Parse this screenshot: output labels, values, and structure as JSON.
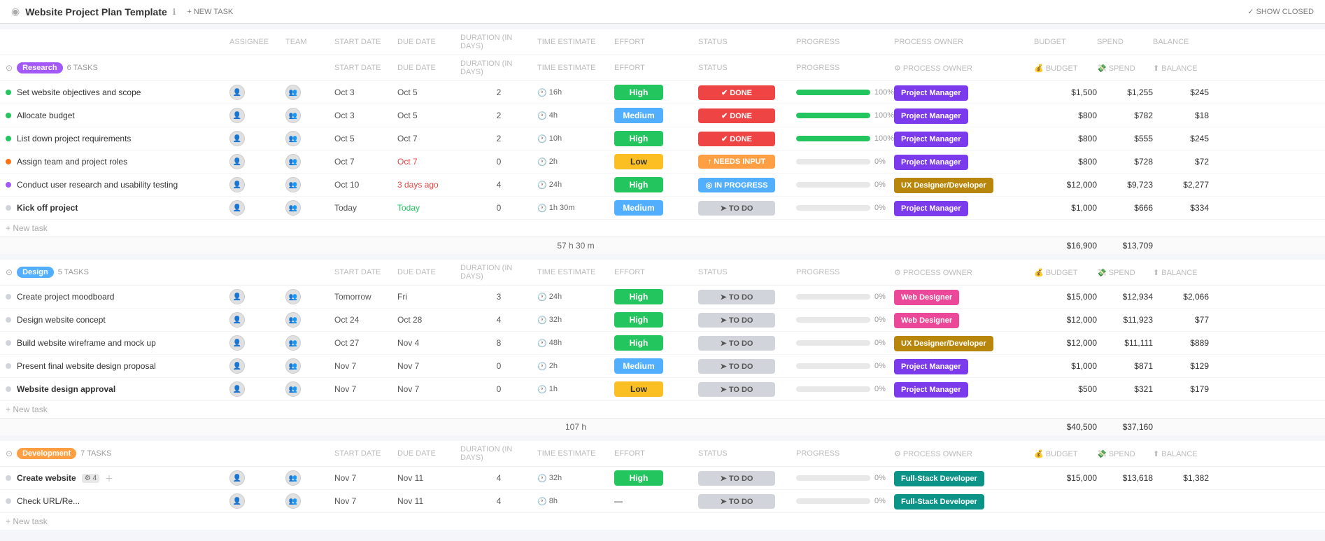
{
  "header": {
    "title": "Website Project Plan Template",
    "info_icon": "ℹ",
    "new_task_label": "+ NEW TASK",
    "show_closed_label": "✓ SHOW CLOSED"
  },
  "columns": [
    "ASSIGNEE",
    "TEAM",
    "START DATE",
    "DUE DATE",
    "DURATION (IN DAYS)",
    "TIME ESTIMATE",
    "EFFORT",
    "STATUS",
    "PROGRESS",
    "PROCESS OWNER",
    "BUDGET",
    "SPEND",
    "BALANCE"
  ],
  "sections": [
    {
      "id": "research",
      "name": "Research",
      "badge_class": "research",
      "task_count": "6 TASKS",
      "tasks": [
        {
          "name": "Set website objectives and scope",
          "dot": "green",
          "bold": false,
          "start": "Oct 3",
          "due": "Oct 5",
          "due_color": "normal",
          "duration": "2",
          "time_est": "16h",
          "effort": "High",
          "effort_class": "high",
          "status": "✔ DONE",
          "status_class": "done",
          "progress": 100,
          "owner": "Project Manager",
          "owner_class": "purple",
          "budget": "$1,500",
          "spend": "$1,255",
          "balance": "$245"
        },
        {
          "name": "Allocate budget",
          "dot": "green",
          "bold": false,
          "start": "Oct 3",
          "due": "Oct 5",
          "due_color": "normal",
          "duration": "2",
          "time_est": "4h",
          "effort": "Medium",
          "effort_class": "medium",
          "status": "✔ DONE",
          "status_class": "done",
          "progress": 100,
          "owner": "Project Manager",
          "owner_class": "purple",
          "budget": "$800",
          "spend": "$782",
          "balance": "$18"
        },
        {
          "name": "List down project requirements",
          "dot": "green",
          "bold": false,
          "start": "Oct 5",
          "due": "Oct 7",
          "due_color": "normal",
          "duration": "2",
          "time_est": "10h",
          "effort": "High",
          "effort_class": "high",
          "status": "✔ DONE",
          "status_class": "done",
          "progress": 100,
          "owner": "Project Manager",
          "owner_class": "purple",
          "budget": "$800",
          "spend": "$555",
          "balance": "$245"
        },
        {
          "name": "Assign team and project roles",
          "dot": "orange",
          "bold": false,
          "start": "Oct 7",
          "due": "Oct 7",
          "due_color": "red",
          "duration": "0",
          "time_est": "2h",
          "effort": "Low",
          "effort_class": "low",
          "status": "↑ NEEDS INPUT",
          "status_class": "needs-input",
          "progress": 0,
          "owner": "Project Manager",
          "owner_class": "purple",
          "budget": "$800",
          "spend": "$728",
          "balance": "$72"
        },
        {
          "name": "Conduct user research and usability testing",
          "dot": "purple",
          "bold": false,
          "start": "Oct 10",
          "due": "3 days ago",
          "due_color": "red",
          "duration": "4",
          "time_est": "24h",
          "effort": "High",
          "effort_class": "high",
          "status": "◎ IN PROGRESS",
          "status_class": "in-progress",
          "progress": 0,
          "owner": "UX Designer/Developer",
          "owner_class": "gold",
          "budget": "$12,000",
          "spend": "$9,723",
          "balance": "$2,277"
        },
        {
          "name": "Kick off project",
          "dot": "gray",
          "bold": true,
          "start": "Today",
          "due": "Today",
          "due_color": "green",
          "duration": "0",
          "time_est": "1h 30m",
          "effort": "Medium",
          "effort_class": "medium",
          "status": "➤ TO DO",
          "status_class": "to-do",
          "progress": 0,
          "owner": "Project Manager",
          "owner_class": "purple",
          "budget": "$1,000",
          "spend": "$666",
          "balance": "$334"
        }
      ],
      "total_time": "57 h 30 m",
      "total_budget": "$16,900",
      "total_spend": "$13,709",
      "total_balance": ""
    },
    {
      "id": "design",
      "name": "Design",
      "badge_class": "design",
      "task_count": "5 TASKS",
      "tasks": [
        {
          "name": "Create project moodboard",
          "dot": "gray",
          "bold": false,
          "start": "Tomorrow",
          "due": "Fri",
          "due_color": "normal",
          "duration": "3",
          "time_est": "24h",
          "effort": "High",
          "effort_class": "high",
          "status": "➤ TO DO",
          "status_class": "to-do",
          "progress": 0,
          "owner": "Web Designer",
          "owner_class": "pink",
          "budget": "$15,000",
          "spend": "$12,934",
          "balance": "$2,066"
        },
        {
          "name": "Design website concept",
          "dot": "gray",
          "bold": false,
          "start": "Oct 24",
          "due": "Oct 28",
          "due_color": "normal",
          "duration": "4",
          "time_est": "32h",
          "effort": "High",
          "effort_class": "high",
          "status": "➤ TO DO",
          "status_class": "to-do",
          "progress": 0,
          "owner": "Web Designer",
          "owner_class": "pink",
          "budget": "$12,000",
          "spend": "$11,923",
          "balance": "$77"
        },
        {
          "name": "Build website wireframe and mock up",
          "dot": "gray",
          "bold": false,
          "start": "Oct 27",
          "due": "Nov 4",
          "due_color": "normal",
          "duration": "8",
          "time_est": "48h",
          "effort": "High",
          "effort_class": "high",
          "status": "➤ TO DO",
          "status_class": "to-do",
          "progress": 0,
          "owner": "UX Designer/Developer",
          "owner_class": "gold",
          "budget": "$12,000",
          "spend": "$11,111",
          "balance": "$889"
        },
        {
          "name": "Present final website design proposal",
          "dot": "gray",
          "bold": false,
          "start": "Nov 7",
          "due": "Nov 7",
          "due_color": "normal",
          "duration": "0",
          "time_est": "2h",
          "effort": "Medium",
          "effort_class": "medium",
          "status": "➤ TO DO",
          "status_class": "to-do",
          "progress": 0,
          "owner": "Project Manager",
          "owner_class": "purple",
          "budget": "$1,000",
          "spend": "$871",
          "balance": "$129"
        },
        {
          "name": "Website design approval",
          "dot": "gray",
          "bold": true,
          "start": "Nov 7",
          "due": "Nov 7",
          "due_color": "normal",
          "duration": "0",
          "time_est": "1h",
          "effort": "Low",
          "effort_class": "low",
          "status": "➤ TO DO",
          "status_class": "to-do",
          "progress": 0,
          "owner": "Project Manager",
          "owner_class": "purple",
          "budget": "$500",
          "spend": "$321",
          "balance": "$179"
        }
      ],
      "total_time": "107 h",
      "total_budget": "$40,500",
      "total_spend": "$37,160",
      "total_balance": ""
    },
    {
      "id": "development",
      "name": "Development",
      "badge_class": "development",
      "task_count": "7 TASKS",
      "tasks": [
        {
          "name": "Create website",
          "dot": "gray",
          "bold": true,
          "has_subtask_count": true,
          "subtask_count": "4",
          "start": "Nov 7",
          "due": "Nov 11",
          "due_color": "normal",
          "duration": "4",
          "time_est": "32h",
          "effort": "High",
          "effort_class": "high",
          "status": "➤ TO DO",
          "status_class": "to-do",
          "progress": 0,
          "owner": "Full-Stack Developer",
          "owner_class": "teal",
          "budget": "$15,000",
          "spend": "$13,618",
          "balance": "$1,382"
        },
        {
          "name": "Check URL/Re...",
          "dot": "gray",
          "bold": false,
          "start": "Nov 7",
          "due": "Nov 11",
          "due_color": "normal",
          "duration": "4",
          "time_est": "8h",
          "effort": "—",
          "effort_class": "",
          "status": "➤ TO DO",
          "status_class": "to-do",
          "progress": 0,
          "owner": "Full-Stack Developer",
          "owner_class": "teal",
          "budget": "",
          "spend": "",
          "balance": ""
        }
      ],
      "total_time": "",
      "total_budget": "",
      "total_spend": "",
      "total_balance": ""
    }
  ],
  "new_task_label": "+ New task"
}
